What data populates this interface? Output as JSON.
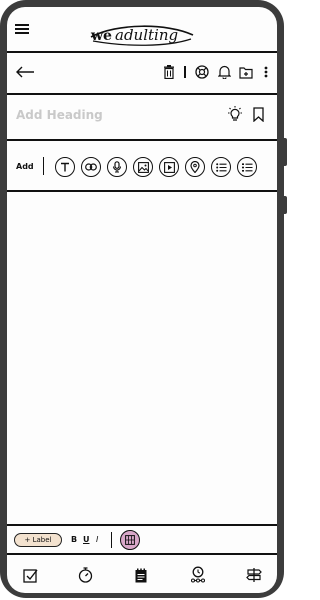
{
  "brand": {
    "logo_text": "weadulting"
  },
  "editor": {
    "heading_placeholder": "Add Heading",
    "add_label": "Add"
  },
  "format_bar": {
    "label_button": "+ Label",
    "bold": "B",
    "underline": "U",
    "italic": "I"
  },
  "colors": {
    "frame": "#3c3c3c",
    "ink": "#111111",
    "label_bg": "#f3e2cf",
    "accent_badge": "#d9a8c9"
  },
  "icons": {
    "top_bar": [
      "hamburger-menu-icon"
    ],
    "toolbar": [
      "back-arrow-icon",
      "trash-icon",
      "lifebuoy-icon",
      "bell-icon",
      "folder-add-icon",
      "more-vert-icon"
    ],
    "heading_row": [
      "lightbulb-icon",
      "bookmark-icon"
    ],
    "insert_tools": [
      "text-icon",
      "link-icon",
      "microphone-icon",
      "image-icon",
      "video-icon",
      "location-pin-icon",
      "bullet-list-icon",
      "numbered-list-icon"
    ],
    "bottom_nav": [
      "checkbox-icon",
      "stopwatch-icon",
      "notes-icon",
      "location-route-icon",
      "signpost-icon"
    ]
  }
}
